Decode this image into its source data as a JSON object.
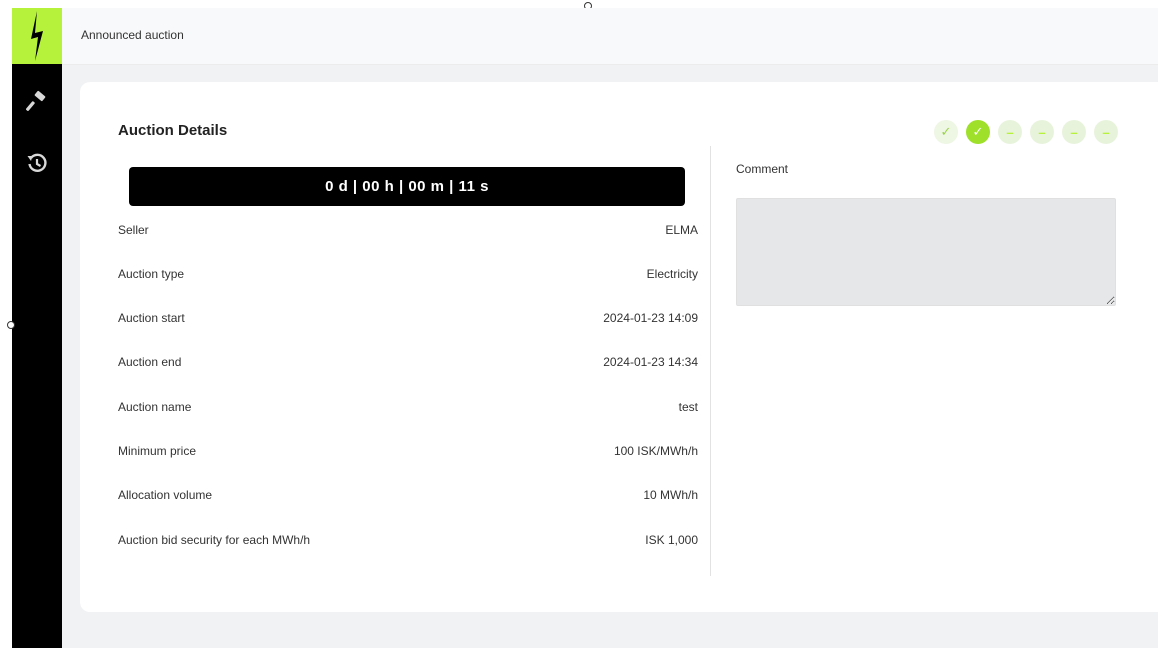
{
  "header": {
    "title": "Announced auction"
  },
  "sidebar": {
    "logo_icon": "lightning-bolt-icon",
    "items": [
      {
        "name": "hammer-icon"
      },
      {
        "name": "history-icon"
      }
    ]
  },
  "card": {
    "heading": "Auction Details",
    "timer": "0 d | 00 h | 00 m | 11 s",
    "details": [
      {
        "label": "Seller",
        "value": "ELMA"
      },
      {
        "label": "Auction type",
        "value": "Electricity"
      },
      {
        "label": "Auction start",
        "value": "2024-01-23 14:09"
      },
      {
        "label": "Auction end",
        "value": "2024-01-23 14:34"
      },
      {
        "label": "Auction name",
        "value": "test"
      },
      {
        "label": "Minimum price",
        "value": "100 ISK/MWh/h"
      },
      {
        "label": "Allocation volume",
        "value": "10 MWh/h"
      },
      {
        "label": "Auction bid security for each MWh/h",
        "value": "ISK 1,000"
      }
    ],
    "comment": {
      "label": "Comment",
      "value": ""
    },
    "steps": [
      {
        "status": "done",
        "symbol": "✓"
      },
      {
        "status": "current",
        "symbol": "✓"
      },
      {
        "status": "pending",
        "symbol": "–"
      },
      {
        "status": "pending",
        "symbol": "–"
      },
      {
        "status": "pending",
        "symbol": "–"
      },
      {
        "status": "pending",
        "symbol": "–"
      }
    ]
  },
  "colors": {
    "accent": "#b6f23c",
    "step_current": "#9ee02a",
    "sidebar": "#000000",
    "timer_bg": "#000000"
  }
}
